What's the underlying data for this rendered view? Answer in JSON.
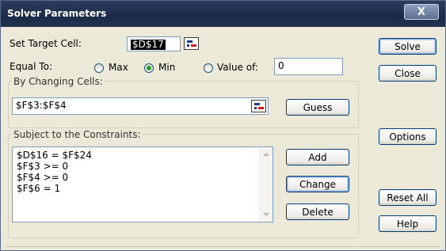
{
  "window": {
    "title": "Solver Parameters",
    "close_label": "X"
  },
  "target": {
    "label": "Set Target Cell:",
    "value": "$D$17"
  },
  "equal_to": {
    "label": "Equal To:",
    "options": [
      {
        "label": "Max",
        "checked": false
      },
      {
        "label": "Min",
        "checked": true
      },
      {
        "label": "Value of:",
        "checked": false
      }
    ],
    "value_of": "0"
  },
  "changing": {
    "label": "By Changing Cells:",
    "value": "$F$3:$F$4",
    "guess_label": "Guess"
  },
  "constraints": {
    "label": "Subject to the Constraints:",
    "items": [
      "$D$16 = $F$24",
      "$F$3 >= 0",
      "$F$4 >= 0",
      "$F$6 = 1"
    ],
    "add_label": "Add",
    "change_label": "Change",
    "delete_label": "Delete"
  },
  "right_buttons": {
    "solve": "Solve",
    "close": "Close",
    "options": "Options",
    "reset_all": "Reset All",
    "help": "Help"
  },
  "icons": {
    "cell_reference": "cell-reference-icon",
    "close": "close-icon",
    "scroll_up": "scroll-up-arrow-icon",
    "scroll_down": "scroll-down-arrow-icon"
  },
  "colors": {
    "titlebar": "#1b2a47",
    "dialog_bg": "#ece9d8",
    "selected_field": "#000000",
    "radio_selected": "#21a121"
  }
}
